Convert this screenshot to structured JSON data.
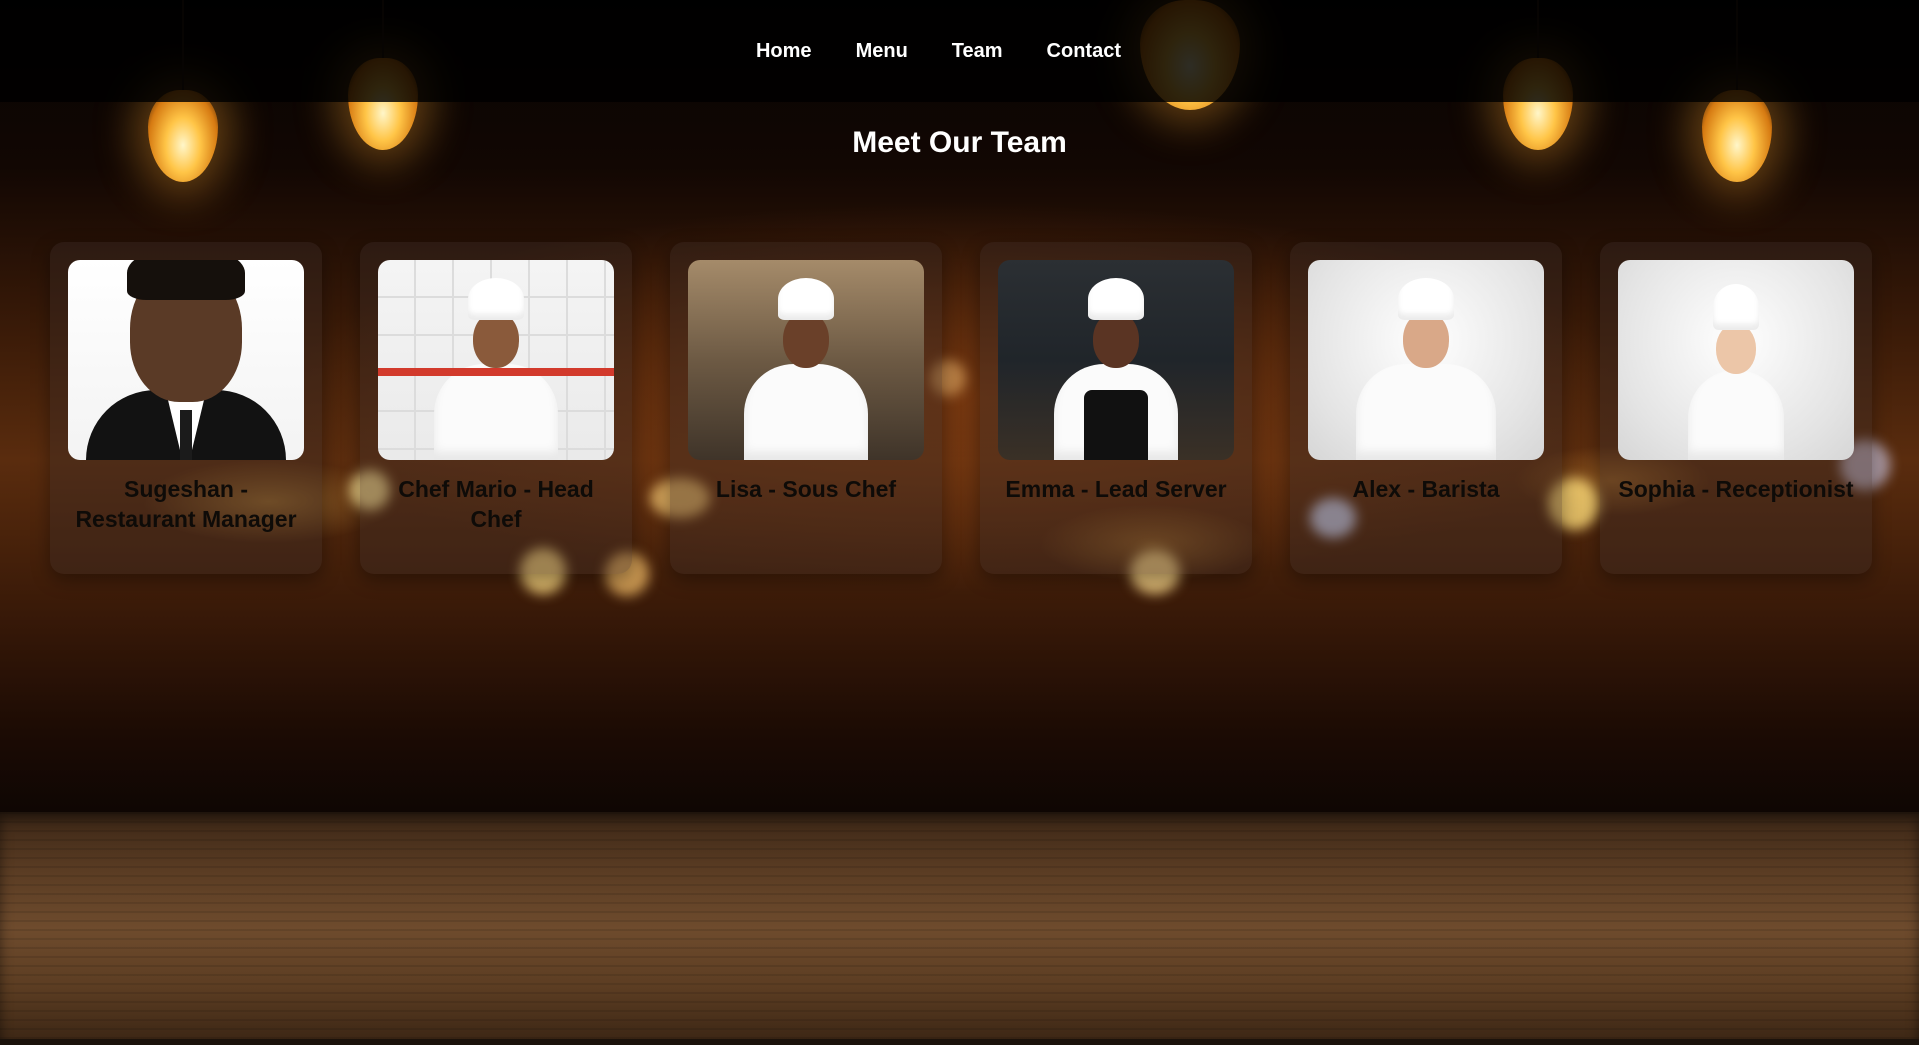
{
  "nav": {
    "links": [
      "Home",
      "Menu",
      "Team",
      "Contact"
    ]
  },
  "page": {
    "title": "Meet Our Team"
  },
  "team": [
    {
      "name": "Sugeshan - Restaurant Manager"
    },
    {
      "name": "Chef Mario - Head Chef"
    },
    {
      "name": "Lisa - Sous Chef"
    },
    {
      "name": "Emma - Lead Server"
    },
    {
      "name": "Alex - Barista"
    },
    {
      "name": "Sophia - Receptionist"
    }
  ],
  "colors": {
    "nav_background": "#000000",
    "title_text": "#ffffff",
    "card_text": "#0e0b08"
  }
}
